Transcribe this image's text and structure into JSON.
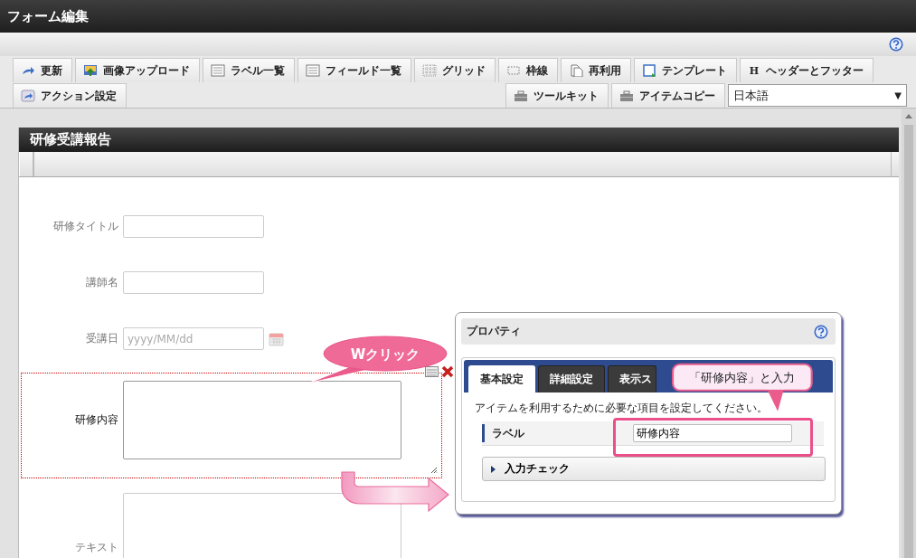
{
  "window": {
    "title": "フォーム編集"
  },
  "toolbar": {
    "row_1": [
      {
        "label": "更新"
      },
      {
        "label": "画像アップロード"
      },
      {
        "label": "ラベル一覧"
      },
      {
        "label": "フィールド一覧"
      },
      {
        "label": "グリッド"
      },
      {
        "label": "枠線"
      },
      {
        "label": "再利用"
      },
      {
        "label": "テンプレート"
      },
      {
        "label": "ヘッダーとフッター",
        "glyph": "H"
      }
    ],
    "row_2_left": [
      {
        "label": "アクション設定"
      }
    ],
    "row_2_right": [
      {
        "label": "ツールキット"
      },
      {
        "label": "アイテムコピー"
      }
    ],
    "language_select": {
      "value": "日本語",
      "caret": "▼"
    }
  },
  "form": {
    "title": "研修受講報告",
    "fields": [
      {
        "label": "研修タイトル",
        "kind": "text",
        "selected": false
      },
      {
        "label": "講師名",
        "kind": "text",
        "selected": false
      },
      {
        "label": "受講日",
        "kind": "date",
        "placeholder": "yyyy/MM/dd",
        "selected": false
      },
      {
        "label": "研修内容",
        "kind": "textarea",
        "selected": true
      },
      {
        "label": "テキスト",
        "kind": "textarea",
        "selected": false
      }
    ]
  },
  "properties": {
    "title": "プロパティ",
    "tabs": [
      {
        "label": "基本設定",
        "selected": true
      },
      {
        "label": "詳細設定",
        "selected": false
      },
      {
        "label": "表示ス",
        "selected": false
      }
    ],
    "description": "アイテムを利用するために必要な項目を設定してください。",
    "label_row": {
      "label": "ラベル",
      "value": "研修内容"
    },
    "section": {
      "label": "入力チェック",
      "expanded": false
    }
  },
  "annotations": [
    {
      "kind": "bubble",
      "text": "Wクリック"
    },
    {
      "kind": "callout",
      "text": "「研修内容」と入力"
    },
    {
      "kind": "highlight"
    },
    {
      "kind": "arrow"
    }
  ]
}
